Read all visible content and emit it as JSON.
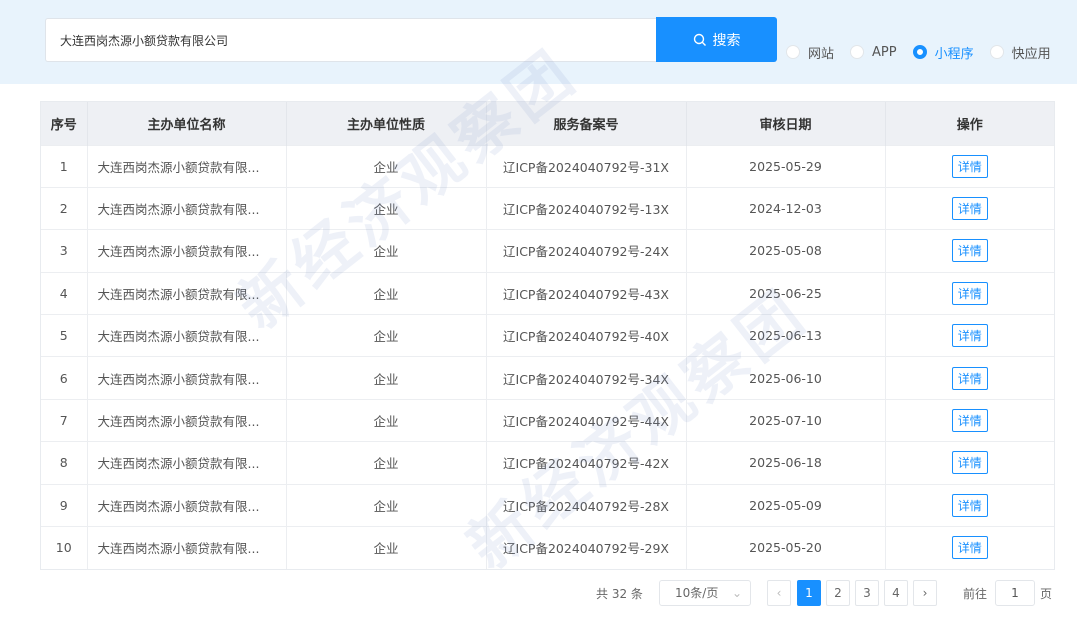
{
  "search": {
    "value": "大连西岗杰源小额贷款有限公司",
    "button_label": "搜索"
  },
  "radio_options": [
    {
      "label": "网站",
      "checked": false
    },
    {
      "label": "APP",
      "checked": false
    },
    {
      "label": "小程序",
      "checked": true
    },
    {
      "label": "快应用",
      "checked": false
    }
  ],
  "table": {
    "headers": [
      "序号",
      "主办单位名称",
      "主办单位性质",
      "服务备案号",
      "审核日期",
      "操作"
    ],
    "detail_label": "详情",
    "rows": [
      {
        "no": "1",
        "name": "大连西岗杰源小额贷款有限...",
        "type": "企业",
        "icp": "辽ICP备2024040792号-31X",
        "date": "2025-05-29"
      },
      {
        "no": "2",
        "name": "大连西岗杰源小额贷款有限...",
        "type": "企业",
        "icp": "辽ICP备2024040792号-13X",
        "date": "2024-12-03"
      },
      {
        "no": "3",
        "name": "大连西岗杰源小额贷款有限...",
        "type": "企业",
        "icp": "辽ICP备2024040792号-24X",
        "date": "2025-05-08"
      },
      {
        "no": "4",
        "name": "大连西岗杰源小额贷款有限...",
        "type": "企业",
        "icp": "辽ICP备2024040792号-43X",
        "date": "2025-06-25"
      },
      {
        "no": "5",
        "name": "大连西岗杰源小额贷款有限...",
        "type": "企业",
        "icp": "辽ICP备2024040792号-40X",
        "date": "2025-06-13"
      },
      {
        "no": "6",
        "name": "大连西岗杰源小额贷款有限...",
        "type": "企业",
        "icp": "辽ICP备2024040792号-34X",
        "date": "2025-06-10"
      },
      {
        "no": "7",
        "name": "大连西岗杰源小额贷款有限...",
        "type": "企业",
        "icp": "辽ICP备2024040792号-44X",
        "date": "2025-07-10"
      },
      {
        "no": "8",
        "name": "大连西岗杰源小额贷款有限...",
        "type": "企业",
        "icp": "辽ICP备2024040792号-42X",
        "date": "2025-06-18"
      },
      {
        "no": "9",
        "name": "大连西岗杰源小额贷款有限...",
        "type": "企业",
        "icp": "辽ICP备2024040792号-28X",
        "date": "2025-05-09"
      },
      {
        "no": "10",
        "name": "大连西岗杰源小额贷款有限...",
        "type": "企业",
        "icp": "辽ICP备2024040792号-29X",
        "date": "2025-05-20"
      }
    ]
  },
  "pagination": {
    "total": "共 32 条",
    "page_size": "10条/页",
    "pages": [
      "1",
      "2",
      "3",
      "4"
    ],
    "current_page": "1",
    "goto_label": "前往",
    "goto_value": "1",
    "page_unit": "页"
  },
  "watermark": "新经济观察团",
  "colors": {
    "accent": "#1890ff",
    "top_band": "#e8f3fc",
    "header_bg": "#eef0f4"
  }
}
